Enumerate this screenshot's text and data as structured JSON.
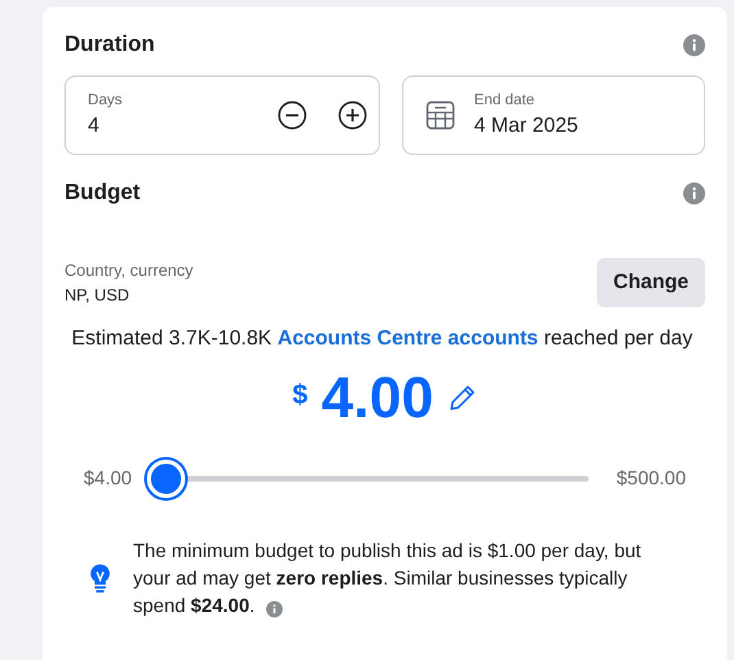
{
  "duration": {
    "title": "Duration",
    "days": {
      "label": "Days",
      "value": "4"
    },
    "end_date": {
      "label": "End date",
      "value": "4 Mar 2025"
    }
  },
  "budget": {
    "title": "Budget",
    "country": {
      "label": "Country, currency",
      "value": "NP, USD"
    },
    "change_button": "Change",
    "estimate": {
      "before": "Estimated 3.7K-10.8K",
      "link": "Accounts Centre accounts",
      "after": "reached per day"
    },
    "currency_symbol": "$",
    "amount": "4.00",
    "slider": {
      "min": "$4.00",
      "max": "$500.00",
      "level": 0
    },
    "tip": "The minimum budget to publish this ad is $1.00 per day, but your ad may get **zero replies**. Similar businesses typically spend **$24.00**."
  }
}
